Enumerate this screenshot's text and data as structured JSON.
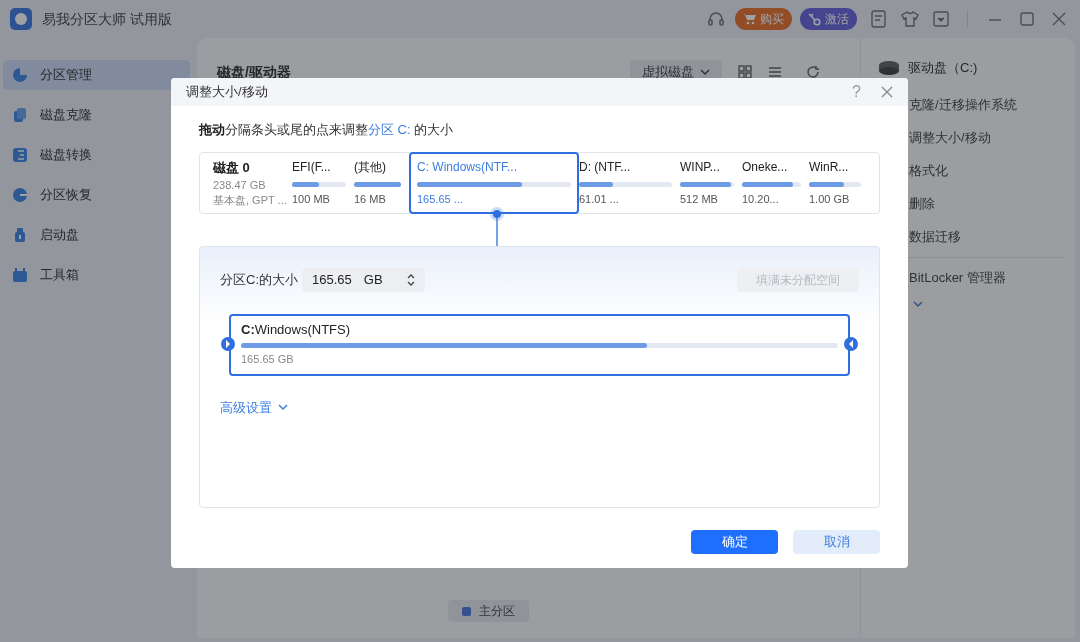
{
  "window": {
    "title": "易我分区大师 试用版"
  },
  "toolbar": {
    "buy": "购买",
    "activate": "激活"
  },
  "sidebar": {
    "items": [
      {
        "label": "分区管理",
        "selected": true
      },
      {
        "label": "磁盘克隆",
        "selected": false
      },
      {
        "label": "磁盘转换",
        "selected": false
      },
      {
        "label": "分区恢复",
        "selected": false
      },
      {
        "label": "启动盘",
        "selected": false
      },
      {
        "label": "工具箱",
        "selected": false
      }
    ]
  },
  "main": {
    "title": "磁盘/驱动器",
    "virtual_disk": "虚拟磁盘",
    "legend": "主分区"
  },
  "right_panel": {
    "title": "驱动盘（C:)",
    "actions": [
      "克隆/迁移操作系统",
      "调整大小/移动",
      "格式化",
      "删除",
      "数据迁移"
    ],
    "bitlocker": "BitLocker 管理器"
  },
  "dialog": {
    "title": "调整大小/移动",
    "help": "?",
    "instruction": [
      {
        "text": "拖动",
        "kind": "bold"
      },
      {
        "text": "分隔条头或尾的点来调整",
        "kind": "plain"
      },
      {
        "text": "分区 C:",
        "kind": "link"
      },
      {
        "text": " 的大小",
        "kind": "plain"
      }
    ],
    "disk": {
      "name": "磁盘 0",
      "size": "238.47 GB",
      "type": "基本盘, GPT ..."
    },
    "partitions": [
      {
        "name": "EFI(F...",
        "size": "100 MB",
        "level": 0.5,
        "selected": false
      },
      {
        "name": "(其他)",
        "size": "16 MB",
        "level": 1.0,
        "selected": false
      },
      {
        "name": "C: Windows(NTF...",
        "size": "165.65 ...",
        "level": 0.68,
        "selected": true
      },
      {
        "name": "D: (NTF...",
        "size": "61.01 ...",
        "level": 0.37,
        "selected": false
      },
      {
        "name": "WINP...",
        "size": "512 MB",
        "level": 0.95,
        "selected": false
      },
      {
        "name": "Oneke...",
        "size": "10.20...",
        "level": 0.87,
        "selected": false
      },
      {
        "name": "WinR...",
        "size": "1.00 GB",
        "level": 0.68,
        "selected": false
      }
    ],
    "size_field": {
      "label": "分区C:的大小",
      "value": "165.65",
      "unit": "GB"
    },
    "fill_button": {
      "label": "填满未分配空间",
      "disabled": true
    },
    "bar": {
      "letter": "C:",
      "label": "Windows(NTFS)",
      "size": "165.65 GB",
      "level": 0.68
    },
    "advanced": "高级设置",
    "ok": "确定",
    "cancel": "取消"
  }
}
